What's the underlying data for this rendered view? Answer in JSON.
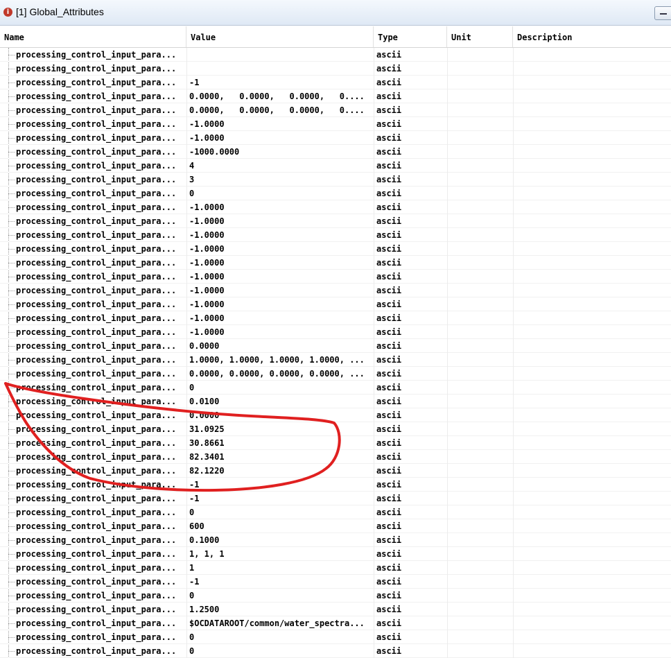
{
  "window": {
    "title": "[1] Global_Attributes"
  },
  "columns": {
    "name": "Name",
    "value": "Value",
    "type": "Type",
    "unit": "Unit",
    "description": "Description"
  },
  "rows": [
    {
      "name": "processing_control_input_para...",
      "value": "",
      "type": "ascii"
    },
    {
      "name": "processing_control_input_para...",
      "value": "",
      "type": "ascii"
    },
    {
      "name": "processing_control_input_para...",
      "value": "-1",
      "type": "ascii"
    },
    {
      "name": "processing_control_input_para...",
      "value": "0.0000,   0.0000,   0.0000,   0....",
      "type": "ascii"
    },
    {
      "name": "processing_control_input_para...",
      "value": "0.0000,   0.0000,   0.0000,   0....",
      "type": "ascii"
    },
    {
      "name": "processing_control_input_para...",
      "value": "-1.0000",
      "type": "ascii"
    },
    {
      "name": "processing_control_input_para...",
      "value": "-1.0000",
      "type": "ascii"
    },
    {
      "name": "processing_control_input_para...",
      "value": "-1000.0000",
      "type": "ascii"
    },
    {
      "name": "processing_control_input_para...",
      "value": "4",
      "type": "ascii"
    },
    {
      "name": "processing_control_input_para...",
      "value": "3",
      "type": "ascii"
    },
    {
      "name": "processing_control_input_para...",
      "value": "0",
      "type": "ascii"
    },
    {
      "name": "processing_control_input_para...",
      "value": "-1.0000",
      "type": "ascii"
    },
    {
      "name": "processing_control_input_para...",
      "value": "-1.0000",
      "type": "ascii"
    },
    {
      "name": "processing_control_input_para...",
      "value": "-1.0000",
      "type": "ascii"
    },
    {
      "name": "processing_control_input_para...",
      "value": "-1.0000",
      "type": "ascii"
    },
    {
      "name": "processing_control_input_para...",
      "value": "-1.0000",
      "type": "ascii"
    },
    {
      "name": "processing_control_input_para...",
      "value": "-1.0000",
      "type": "ascii"
    },
    {
      "name": "processing_control_input_para...",
      "value": "-1.0000",
      "type": "ascii"
    },
    {
      "name": "processing_control_input_para...",
      "value": "-1.0000",
      "type": "ascii"
    },
    {
      "name": "processing_control_input_para...",
      "value": "-1.0000",
      "type": "ascii"
    },
    {
      "name": "processing_control_input_para...",
      "value": "-1.0000",
      "type": "ascii"
    },
    {
      "name": "processing_control_input_para...",
      "value": "0.0000",
      "type": "ascii"
    },
    {
      "name": "processing_control_input_para...",
      "value": "1.0000, 1.0000, 1.0000, 1.0000, ...",
      "type": "ascii"
    },
    {
      "name": "processing_control_input_para...",
      "value": "0.0000, 0.0000, 0.0000, 0.0000, ...",
      "type": "ascii"
    },
    {
      "name": "processing_control_input_para...",
      "value": "0",
      "type": "ascii"
    },
    {
      "name": "processing_control_input_para...",
      "value": "0.0100",
      "type": "ascii"
    },
    {
      "name": "processing_control_input_para...",
      "value": "0.0000",
      "type": "ascii"
    },
    {
      "name": "processing_control_input_para...",
      "value": "31.0925",
      "type": "ascii"
    },
    {
      "name": "processing_control_input_para...",
      "value": "30.8661",
      "type": "ascii"
    },
    {
      "name": "processing_control_input_para...",
      "value": "82.3401",
      "type": "ascii"
    },
    {
      "name": "processing_control_input_para...",
      "value": "82.1220",
      "type": "ascii"
    },
    {
      "name": "processing_control_input_para...",
      "value": "-1",
      "type": "ascii"
    },
    {
      "name": "processing_control_input_para...",
      "value": "-1",
      "type": "ascii"
    },
    {
      "name": "processing_control_input_para...",
      "value": "0",
      "type": "ascii"
    },
    {
      "name": "processing_control_input_para...",
      "value": "600",
      "type": "ascii"
    },
    {
      "name": "processing_control_input_para...",
      "value": "0.1000",
      "type": "ascii"
    },
    {
      "name": "processing_control_input_para...",
      "value": "1, 1, 1",
      "type": "ascii"
    },
    {
      "name": "processing_control_input_para...",
      "value": "1",
      "type": "ascii"
    },
    {
      "name": "processing_control_input_para...",
      "value": "-1",
      "type": "ascii"
    },
    {
      "name": "processing_control_input_para...",
      "value": "0",
      "type": "ascii"
    },
    {
      "name": "processing_control_input_para...",
      "value": "1.2500",
      "type": "ascii"
    },
    {
      "name": "processing_control_input_para...",
      "value": "$OCDATAROOT/common/water_spectra...",
      "type": "ascii"
    },
    {
      "name": "processing_control_input_para...",
      "value": "0",
      "type": "ascii"
    },
    {
      "name": "processing_control_input_para...",
      "value": "0",
      "type": "ascii"
    }
  ],
  "annotation": {
    "color": "#e02020"
  }
}
